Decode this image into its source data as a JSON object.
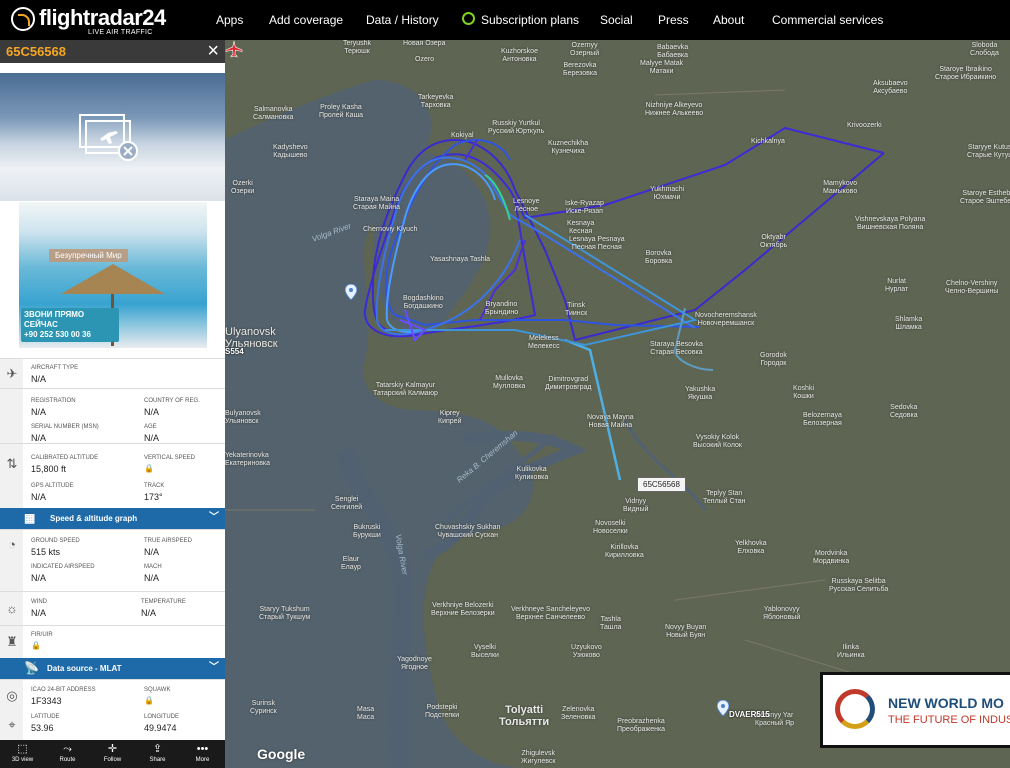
{
  "nav": {
    "logo_text": "flightradar24",
    "logo_sub": "LIVE AIR TRAFFIC",
    "items": [
      "Apps",
      "Add coverage",
      "Data / History",
      "Subscription plans",
      "Social",
      "Press",
      "About",
      "Commercial services"
    ]
  },
  "panel": {
    "callsign": "65C56568",
    "ad_banner": "Безупречный Мир",
    "ad_cta_line1": "ЗВОНИ ПРЯМО СЕЙЧАС",
    "ad_cta_line2": "+90 252 530 00 36",
    "fields": {
      "aircraft_type_label": "AIRCRAFT TYPE",
      "aircraft_type": "N/A",
      "registration_label": "REGISTRATION",
      "registration": "N/A",
      "country_label": "COUNTRY OF REG.",
      "country": "N/A",
      "msn_label": "SERIAL NUMBER (MSN)",
      "msn": "N/A",
      "age_label": "AGE",
      "age": "N/A",
      "cal_alt_label": "CALIBRATED ALTITUDE",
      "cal_alt": "15,800 ft",
      "vspeed_label": "VERTICAL SPEED",
      "gps_alt_label": "GPS ALTITUDE",
      "gps_alt": "N/A",
      "track_label": "TRACK",
      "track": "173°",
      "ground_speed_label": "GROUND SPEED",
      "ground_speed": "515 kts",
      "true_airspeed_label": "TRUE AIRSPEED",
      "true_airspeed": "N/A",
      "indicated_airspeed_label": "INDICATED AIRSPEED",
      "indicated_airspeed": "N/A",
      "mach_label": "MACH",
      "mach": "N/A",
      "wind_label": "WIND",
      "wind": "N/A",
      "temperature_label": "TEMPERATURE",
      "temperature": "N/A",
      "fir_label": "FIR/UIR",
      "icao_label": "ICAO 24-BIT ADDRESS",
      "icao": "1F3343",
      "squawk_label": "SQUAWK",
      "latitude_label": "LATITUDE",
      "latitude": "53.96",
      "longitude_label": "LONGITUDE",
      "longitude": "49.9474"
    },
    "speed_graph_label": "Speed & altitude graph",
    "data_source_label": "Data source - MLAT",
    "tools": [
      "3D view",
      "Route",
      "Follow",
      "Share",
      "More"
    ]
  },
  "map": {
    "plane_tag": "65C56568",
    "airport_label": "DVAER515",
    "left_airport_label": "S554",
    "rivers": [
      "Volga River",
      "Reka B. Cheremshan",
      "Volga River"
    ],
    "labels": [
      {
        "t": [
          "Teryushk",
          "Терюшк"
        ]
      },
      {
        "t": [
          "Ozero"
        ]
      },
      {
        "t": [
          "Новая Озера"
        ]
      },
      {
        "t": [
          "Kuzhorskoe",
          "Антоновка"
        ]
      },
      {
        "t": [
          "Ozernyy",
          "Озерный"
        ]
      },
      {
        "t": [
          "Berezovka",
          "Березовка"
        ]
      },
      {
        "t": [
          "Babaevka",
          "Бабаевка"
        ]
      },
      {
        "t": [
          "Malyye Matak",
          "Матаки"
        ]
      },
      {
        "t": [
          "Aksubaevo",
          "Аксубаево"
        ]
      },
      {
        "t": [
          "Sloboda",
          "Слобода"
        ]
      },
      {
        "t": [
          "Staroye Ibraikino",
          "Старое Ибраикино"
        ]
      },
      {
        "t": [
          "Salmanovka",
          "Салмановка"
        ]
      },
      {
        "t": [
          "Proley Kasha",
          "Пролей Каша"
        ]
      },
      {
        "t": [
          "Tarkeyevka",
          "Тарховка"
        ]
      },
      {
        "t": [
          "Nizhniye Alkeyevo",
          "Нижнее Алькеево"
        ]
      },
      {
        "t": [
          "Kadyshevo",
          "Кадышево"
        ]
      },
      {
        "t": [
          "Russkiy Yurtkul",
          "Русский Юрткуль"
        ]
      },
      {
        "t": [
          "Kuznechikha",
          "Кузнечиха"
        ]
      },
      {
        "t": [
          "Kichkalnya",
          "Кичкальня"
        ]
      },
      {
        "t": [
          "Krivoozerki",
          "Кривоозерки"
        ]
      },
      {
        "t": [
          "Ozerki",
          "Озерки"
        ]
      },
      {
        "t": [
          "Kokiyal"
        ]
      },
      {
        "t": [
          "Staryye Kutushi",
          "Старые Кутуши"
        ]
      },
      {
        "t": [
          "Yukhmachi",
          "Юхмачи"
        ]
      },
      {
        "t": [
          "Mamykovo",
          "Мамыково"
        ]
      },
      {
        "t": [
          "Staroye Esthebenkino",
          "Старое Эштебенькино"
        ]
      },
      {
        "t": [
          "Staraya Maina",
          "Старая Майна"
        ]
      },
      {
        "t": [
          "Lesnoye",
          "Лесное"
        ]
      },
      {
        "t": [
          "Iske-Ryazap",
          "Иске-Рязап"
        ]
      },
      {
        "t": [
          "Kesnaya",
          "Кесная"
        ]
      },
      {
        "t": [
          "Chernoviy Klyuch"
        ]
      },
      {
        "t": [
          "Lesnaya Pesnaya",
          "Песная Песная"
        ]
      },
      {
        "t": [
          "Oktyabr",
          "Октябрь"
        ]
      },
      {
        "t": [
          "Vishnevskaya Polyana",
          "Вишневская Поляна"
        ]
      },
      {
        "t": [
          "Borovka",
          "Боровка"
        ]
      },
      {
        "t": [
          "Nurlat",
          "Нурлат"
        ]
      },
      {
        "t": [
          "Chelno-Vershiny",
          "Челно-Вершины"
        ]
      },
      {
        "t": [
          "Yasashnaya Tashla"
        ]
      },
      {
        "t": [
          "Bogdashkino",
          "Богдашкино"
        ]
      },
      {
        "t": [
          "Bryandino",
          "Брындино"
        ]
      },
      {
        "t": [
          "Tiinsk",
          "Тиинск"
        ]
      },
      {
        "t": [
          "Shlamka",
          "Шламка"
        ]
      },
      {
        "t": [
          "Novocheremshansk",
          "Новочеремшанск"
        ]
      },
      {
        "t": [
          "Melekess",
          "Мелекесс"
        ]
      },
      {
        "t": [
          "Staraya Besovka",
          "Старая Бесовка"
        ]
      },
      {
        "t": [
          "Ulyanovsk",
          "Ульяновск"
        ]
      },
      {
        "t": [
          "Mullovka",
          "Мулловка"
        ]
      },
      {
        "t": [
          "Dimitrovgrad",
          "Димитровград"
        ]
      },
      {
        "t": [
          "Gorodok",
          "Городок"
        ]
      },
      {
        "t": [
          "Tatarskiy Kalmayur",
          "Татарский Калмаюр"
        ]
      },
      {
        "t": [
          "Yakushka",
          "Якушка"
        ]
      },
      {
        "t": [
          "Koshki",
          "Кошки"
        ]
      },
      {
        "t": [
          "Belozernaya",
          "Белозерная"
        ]
      },
      {
        "t": [
          "Sedovka",
          "Седовка"
        ]
      },
      {
        "t": [
          "Bulyanovsk",
          "Ульяновск"
        ]
      },
      {
        "t": [
          "Kiprey",
          "Кипрей"
        ]
      },
      {
        "t": [
          "Novaya Mayna",
          "Новая Майна"
        ]
      },
      {
        "t": [
          "Vysokiy Kolok",
          "Высокий Колок"
        ]
      },
      {
        "t": [
          "Yekaterinovka",
          "Екатериновка"
        ]
      },
      {
        "t": [
          "Kulikovka",
          "Куликовка"
        ]
      },
      {
        "t": [
          "Teplyy Stan",
          "Теплый Стан"
        ]
      },
      {
        "t": [
          "Senglei",
          "Сенгилей"
        ]
      },
      {
        "t": [
          "Vidnyy",
          "Видный"
        ]
      },
      {
        "t": [
          "Novoselki",
          "Новоселки"
        ]
      },
      {
        "t": [
          "Bukruski",
          "Бурукши"
        ]
      },
      {
        "t": [
          "Chuvashskiy Sukhan",
          "Чувашский Сускан"
        ]
      },
      {
        "t": [
          "Kirillovka",
          "Кирилловка"
        ]
      },
      {
        "t": [
          "Yelkhovka",
          "Елховка"
        ]
      },
      {
        "t": [
          "Mordvinka",
          "Мордвинка"
        ]
      },
      {
        "t": [
          "Elaur",
          "Елаур"
        ]
      },
      {
        "t": [
          "Russkaya Selitba",
          "Русская Селитьба"
        ]
      },
      {
        "t": [
          "Staryy Tukshum",
          "Старый Тукшум"
        ]
      },
      {
        "t": [
          "Verkhniye Belozerki",
          "Верхние Белозерки"
        ]
      },
      {
        "t": [
          "Yablonovyy",
          "Яблоновый"
        ]
      },
      {
        "t": [
          "Ilinka",
          "Ильинка"
        ]
      },
      {
        "t": [
          "Novyy Buyan",
          "Новый Буян"
        ]
      },
      {
        "t": [
          "Verkhneye Sancheleyevo",
          "Верхнее Санчелеево"
        ]
      },
      {
        "t": [
          "Tashla",
          "Ташла"
        ]
      },
      {
        "t": [
          "Vyselki",
          "Выселки"
        ]
      },
      {
        "t": [
          "Uzyukovo",
          "Узюково"
        ]
      },
      {
        "t": [
          "Yagodnoye",
          "Ягодное"
        ]
      },
      {
        "t": [
          "Tolyatti",
          "Тольятти"
        ]
      },
      {
        "t": [
          "Zelenovka",
          "Зеленовка"
        ]
      },
      {
        "t": [
          "Surinsk",
          "Суринск"
        ]
      },
      {
        "t": [
          "Masa",
          "Маса"
        ]
      },
      {
        "t": [
          "Podstepki",
          "Подстепки"
        ]
      },
      {
        "t": [
          "Preobrazhenka",
          "Преображенка"
        ]
      },
      {
        "t": [
          "Zhigulevsk",
          "Жигулевск"
        ]
      },
      {
        "t": [
          "Krasnyy Yar",
          "Красный Яр"
        ]
      }
    ],
    "ad_title": "NEW WORLD MO",
    "ad_sub": "THE FUTURE OF INDUS",
    "google": "Google"
  }
}
